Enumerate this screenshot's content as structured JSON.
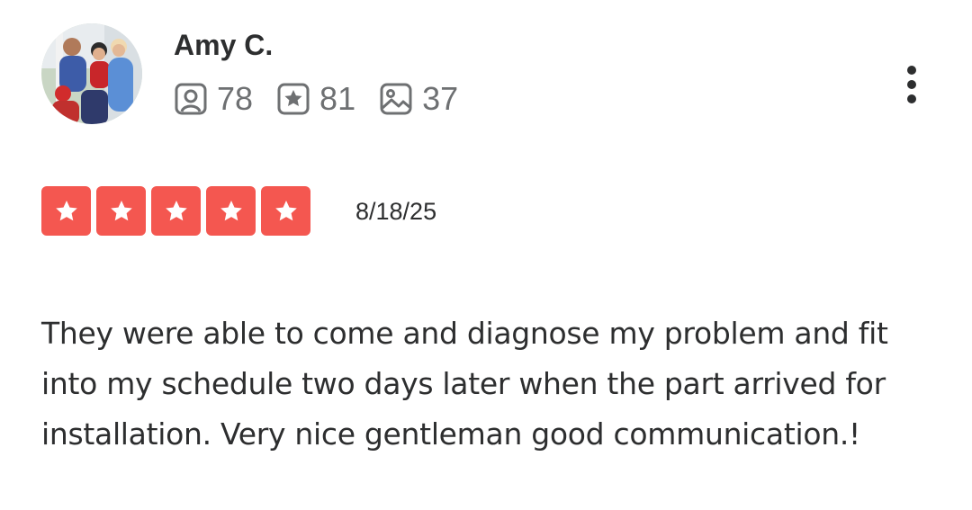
{
  "review": {
    "user": {
      "name": "Amy C.",
      "stats": [
        {
          "icon": "friends-icon",
          "count": "78"
        },
        {
          "icon": "reviews-star-icon",
          "count": "81"
        },
        {
          "icon": "photos-icon",
          "count": "37"
        }
      ]
    },
    "rating": 5,
    "rating_max": 5,
    "date": "8/18/25",
    "text": "They were able to come and diagnose my problem and fit into my schedule two days later when the part arrived for installation. Very nice gentleman good communication.!"
  },
  "colors": {
    "star_fill": "#f45750",
    "text_primary": "#2d2e2f",
    "text_secondary": "#6e7072"
  }
}
